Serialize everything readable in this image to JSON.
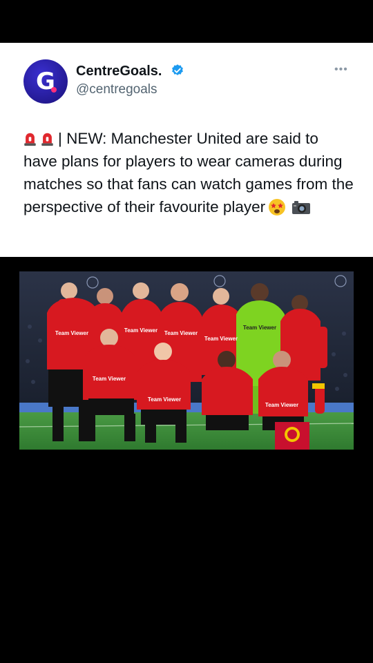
{
  "author": {
    "name": "CentreGoals.",
    "handle": "@centregoals",
    "avatar_letter": "G"
  },
  "more_label": "•••",
  "tweet": {
    "text": "| NEW: Manchester United are said to have plans for players to wear cameras during matches so that fans can watch games from the perspective of their favourite player",
    "leading_icons": [
      "siren-icon",
      "siren-icon"
    ],
    "trailing_icons": [
      "starstruck-face-icon",
      "camera-icon"
    ]
  },
  "media": {
    "kit_sponsor_text": "Team Viewer"
  },
  "colors": {
    "verified_blue": "#1d9bf0",
    "avatar_blue": "#2a21b8",
    "kit_red": "#d71920",
    "gk_green": "#7ed321",
    "pitch_green": "#3d8b3d"
  }
}
